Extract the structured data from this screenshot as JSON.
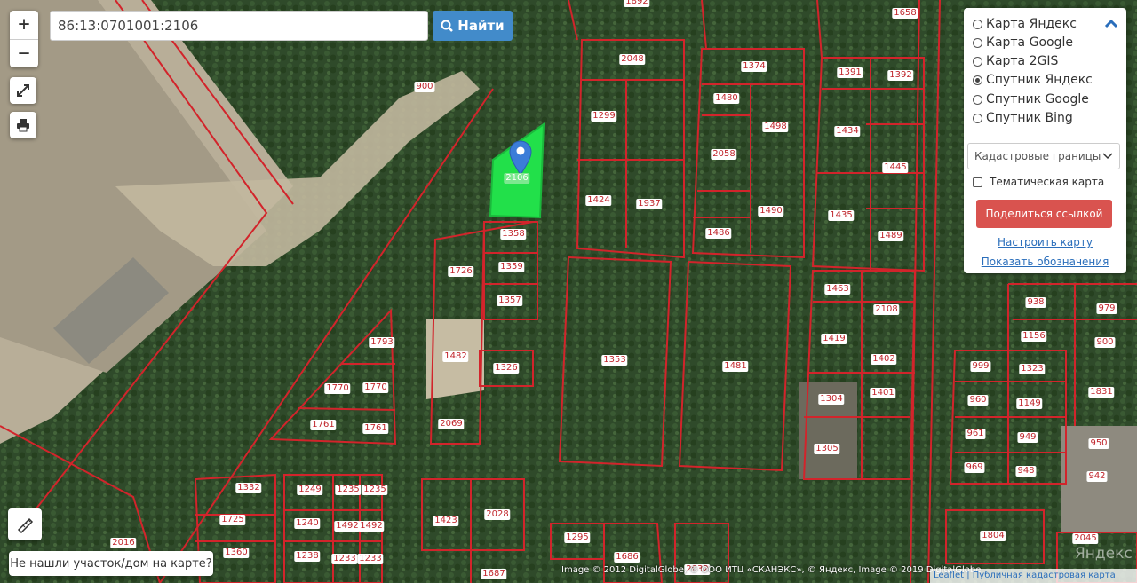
{
  "search": {
    "value": "86:13:0701001:2106"
  },
  "find_label": "Найти",
  "zoom": {
    "in": "+",
    "out": "−"
  },
  "layers": [
    {
      "label": "Карта Яндекс",
      "checked": false
    },
    {
      "label": "Карта Google",
      "checked": false
    },
    {
      "label": "Карта 2GIS",
      "checked": false
    },
    {
      "label": "Спутник Яндекс",
      "checked": true
    },
    {
      "label": "Спутник Google",
      "checked": false
    },
    {
      "label": "Спутник Bing",
      "checked": false
    }
  ],
  "boundaries_select": "Кадастровые границы",
  "thematic_label": "Тематическая карта",
  "share_label": "Поделиться ссылкой",
  "configure_link": "Настроить карту",
  "legend_link": "Показать обозначения",
  "not_found_label": "Не нашли участок/дом на карте?",
  "attribution": "Image © 2012 DigitalGlobe, © ООО ИТЦ «СКАНЭКС», © Яндекс, Image © 2019 DigitalGlobe",
  "leaflet_attribution": "Leaflet | Публичная кадастровая карта",
  "watermark": "Яндекс",
  "selected_plot": "2106",
  "colors": {
    "boundary": "#d2242b",
    "selected": "#22e04a",
    "button": "#428bca",
    "share": "#d9534f"
  },
  "plots": [
    "1892",
    "1658",
    "2048",
    "1374",
    "1391",
    "1392",
    "900",
    "1480",
    "1498",
    "1299",
    "1434",
    "2058",
    "1445",
    "1424",
    "1937",
    "1490",
    "1435",
    "1486",
    "1489",
    "1358",
    "1359",
    "1726",
    "1357",
    "1463",
    "2108",
    "938",
    "979",
    "1793",
    "1156",
    "900",
    "1419",
    "1402",
    "1482",
    "1353",
    "1481",
    "1326",
    "999",
    "1323",
    "1770",
    "1770",
    "1831",
    "1304",
    "1401",
    "960",
    "1149",
    "1761",
    "1761",
    "2069",
    "961",
    "949",
    "950",
    "1305",
    "969",
    "948",
    "942",
    "1332",
    "1249",
    "1235",
    "1235",
    "1725",
    "1240",
    "1492",
    "1492",
    "1423",
    "2028",
    "1360",
    "1238",
    "1233",
    "1233",
    "1295",
    "1686",
    "1804",
    "2045",
    "1687",
    "2032",
    "2016"
  ]
}
